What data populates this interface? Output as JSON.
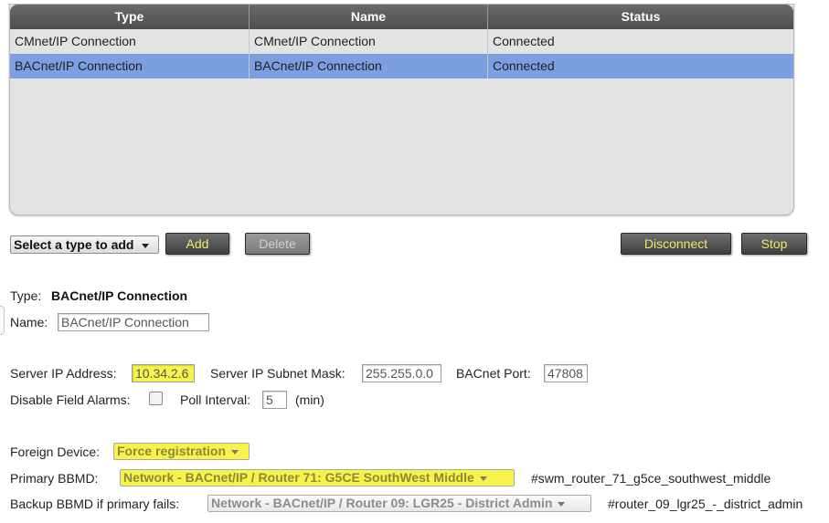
{
  "table": {
    "headers": [
      "Type",
      "Name",
      "Status"
    ],
    "rows": [
      {
        "type": "CMnet/IP Connection",
        "name": "CMnet/IP Connection",
        "status": "Connected",
        "selected": false
      },
      {
        "type": "BACnet/IP Connection",
        "name": "BACnet/IP Connection",
        "status": "Connected",
        "selected": true
      }
    ]
  },
  "toolbar": {
    "type_select": "Select a type to add",
    "add_label": "Add",
    "delete_label": "Delete",
    "disconnect_label": "Disconnect",
    "stop_label": "Stop"
  },
  "details": {
    "type_label": "Type:",
    "type_value": "BACnet/IP Connection",
    "name_label": "Name:",
    "name_value": "BACnet/IP Connection",
    "server_ip_label": "Server IP Address:",
    "server_ip_value": "10.34.2.6",
    "subnet_label": "Server IP Subnet Mask:",
    "subnet_value": "255.255.0.0",
    "port_label": "BACnet Port:",
    "port_value": "47808",
    "disable_alarms_label": "Disable Field Alarms:",
    "disable_alarms_checked": false,
    "poll_label": "Poll Interval:",
    "poll_value": "5",
    "poll_unit": "(min)",
    "foreign_label": "Foreign Device:",
    "foreign_value": "Force registration",
    "primary_label": "Primary BBMD:",
    "primary_value": "Network - BACnet/IP / Router 71: G5CE SouthWest Middle",
    "primary_ref": "#swm_router_71_g5ce_southwest_middle",
    "backup_label": "Backup BBMD if primary fails:",
    "backup_value": "Network - BACnet/IP / Router 09: LGR25 - District Admin",
    "backup_ref": "#router_09_lgr25_-_district_admin"
  },
  "colors": {
    "header_bg": "#555555",
    "selected_row": "#7b9fe0",
    "button_text": "#f4e66a",
    "highlight": "#f7f34a"
  }
}
